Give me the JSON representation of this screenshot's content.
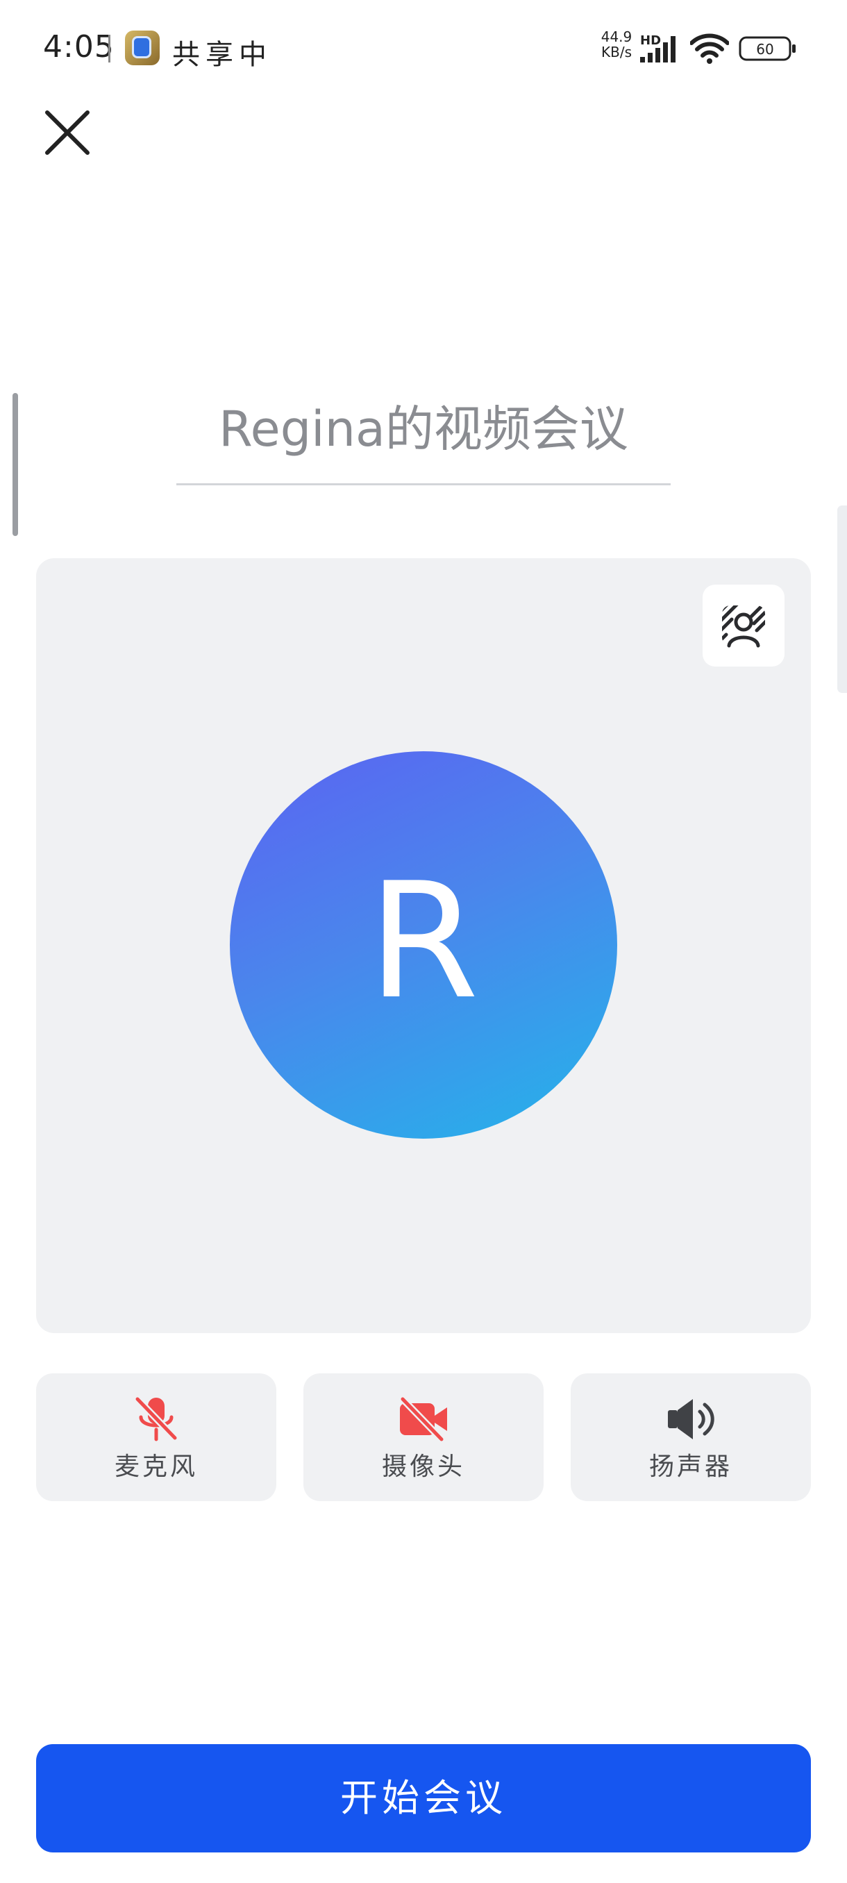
{
  "status_bar": {
    "time": "4:05",
    "sharing": "共享中",
    "speed_value": "44.9",
    "speed_unit": "KB/s",
    "network": "HD",
    "battery": "60"
  },
  "meeting": {
    "title": "Regina的视频会议",
    "avatar_initial": "R",
    "avatar_gradient": [
      "#5b63f2",
      "#24b4ea"
    ]
  },
  "controls": [
    {
      "label": "麦克风",
      "icon": "microphone-off-icon",
      "state": "off",
      "color": "#f04b4b"
    },
    {
      "label": "摄像头",
      "icon": "camera-off-icon",
      "state": "off",
      "color": "#f04b4b"
    },
    {
      "label": "扬声器",
      "icon": "speaker-icon",
      "state": "on",
      "color": "#404246"
    }
  ],
  "start_button": {
    "label": "开始会议",
    "color": "#1656f0"
  }
}
